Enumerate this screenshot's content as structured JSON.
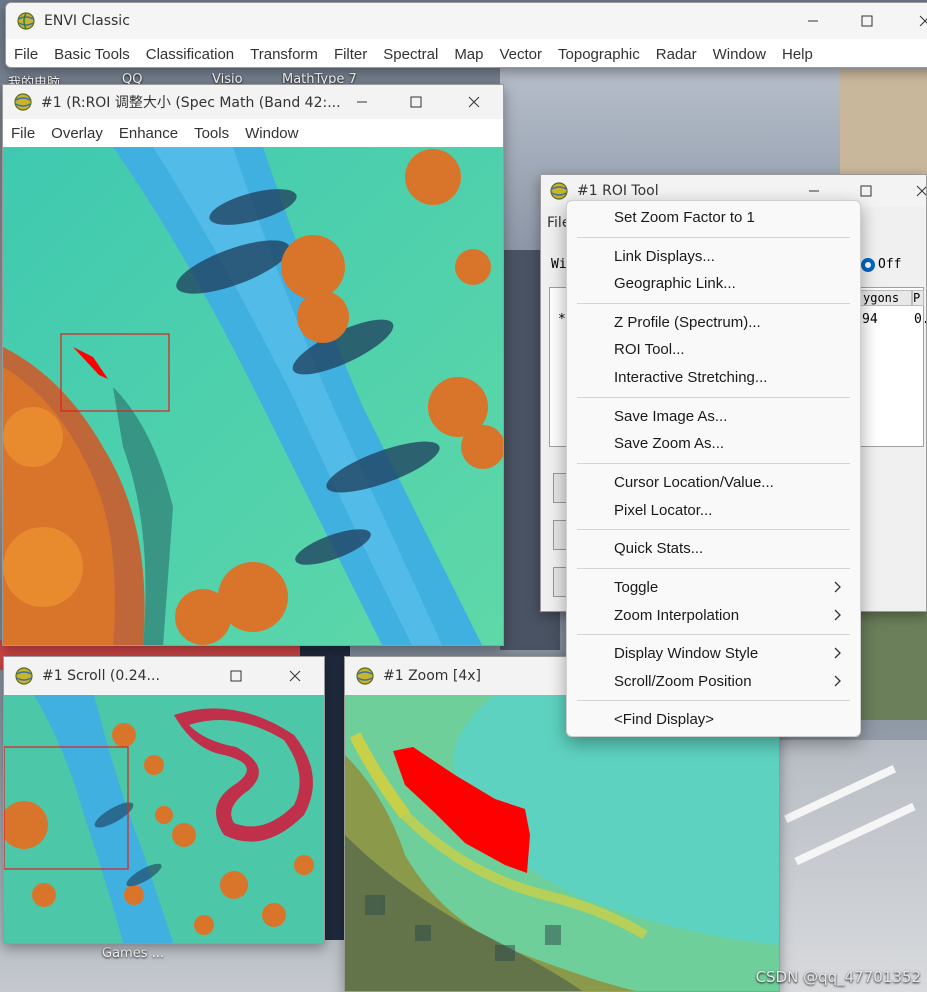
{
  "main_window": {
    "title": "ENVI Classic",
    "menu": [
      "File",
      "Basic Tools",
      "Classification",
      "Transform",
      "Filter",
      "Spectral",
      "Map",
      "Vector",
      "Topographic",
      "Radar",
      "Window",
      "Help"
    ]
  },
  "desktop": {
    "items": [
      "我的电脑",
      "QQ",
      "Visio",
      "MathType 7",
      "Games ..."
    ]
  },
  "display_window": {
    "title": "#1 (R:ROI 调整大小 (Spec Math (Band 42:...",
    "menu": [
      "File",
      "Overlay",
      "Enhance",
      "Tools",
      "Window"
    ]
  },
  "roi_tool": {
    "title": "#1 ROI Tool",
    "file_menu": "File",
    "window_label": "Wi",
    "off_label": "Off",
    "col_polygons": "ygons",
    "col_p": "P",
    "row_marker": "*",
    "row_value": "94",
    "row_value2": "0."
  },
  "scroll_window": {
    "title": "#1 Scroll (0.24..."
  },
  "zoom_window": {
    "title": "#1 Zoom [4x]"
  },
  "context_menu": {
    "items": [
      {
        "label": "Set Zoom Factor to 1",
        "submenu": false
      },
      {
        "label": "Link Displays...",
        "submenu": false
      },
      {
        "label": "Geographic Link...",
        "submenu": false
      },
      {
        "label": "Z Profile (Spectrum)...",
        "submenu": false
      },
      {
        "label": "ROI Tool...",
        "submenu": false
      },
      {
        "label": "Interactive Stretching...",
        "submenu": false
      },
      {
        "label": "Save Image As...",
        "submenu": false
      },
      {
        "label": "Save Zoom As...",
        "submenu": false
      },
      {
        "label": "Cursor Location/Value...",
        "submenu": false
      },
      {
        "label": "Pixel Locator...",
        "submenu": false
      },
      {
        "label": "Quick Stats...",
        "submenu": false
      },
      {
        "label": "Toggle",
        "submenu": true
      },
      {
        "label": "Zoom Interpolation",
        "submenu": true
      },
      {
        "label": "Display Window Style",
        "submenu": true
      },
      {
        "label": "Scroll/Zoom Position",
        "submenu": true
      },
      {
        "label": "<Find Display>",
        "submenu": false
      }
    ]
  },
  "watermark": "CSDN @qq_47701352",
  "colors": {
    "roi": "#ff0000",
    "water": "#3fb0e0",
    "vegetation": "#3fd2b8",
    "trees": "#d8752a",
    "radio_selected": "#0067c0"
  },
  "icons": {
    "envi": "envi-globe-icon",
    "minimize": "minimize-icon",
    "maximize": "maximize-icon",
    "close": "close-icon",
    "submenu": "chevron-right-icon"
  }
}
